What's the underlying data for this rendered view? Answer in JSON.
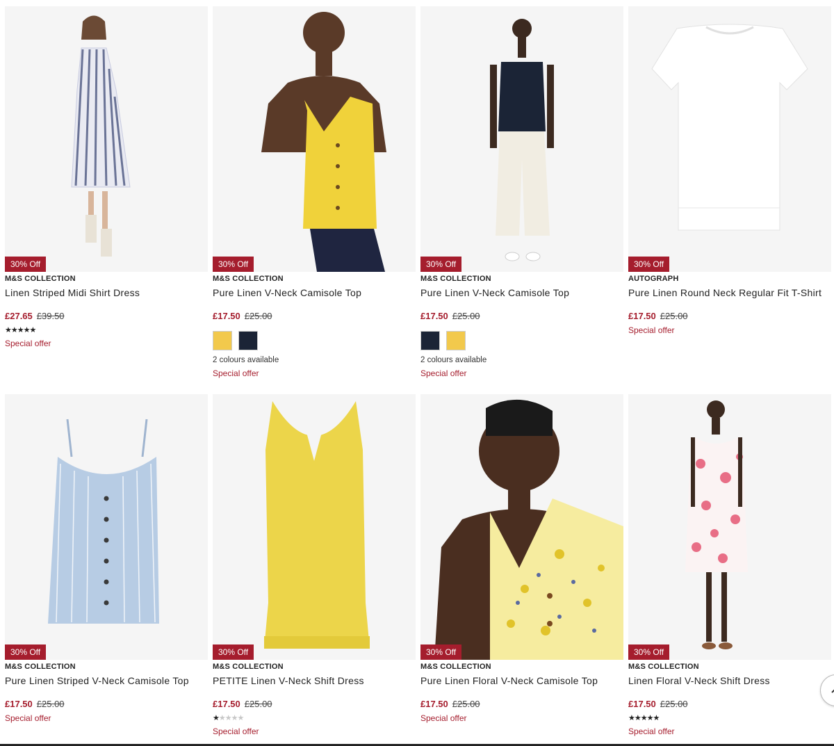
{
  "products": [
    {
      "badge": "30% Off",
      "brand": "M&S COLLECTION",
      "name": "Linen Striped Midi Shirt Dress",
      "price": "£27.65",
      "was": "£39.50",
      "rating": 4.5,
      "colours_text": "",
      "offer": "Special offer"
    },
    {
      "badge": "30% Off",
      "brand": "M&S COLLECTION",
      "name": "Pure Linen V-Neck Camisole Top",
      "price": "£17.50",
      "was": "£25.00",
      "swatches": [
        "#f2c94c",
        "#1b2436"
      ],
      "colours_text": "2 colours available",
      "offer": "Special offer"
    },
    {
      "badge": "30% Off",
      "brand": "M&S COLLECTION",
      "name": "Pure Linen V-Neck Camisole Top",
      "price": "£17.50",
      "was": "£25.00",
      "swatches": [
        "#1b2436",
        "#f2c94c"
      ],
      "colours_text": "2 colours available",
      "offer": "Special offer"
    },
    {
      "badge": "30% Off",
      "brand": "AUTOGRAPH",
      "name": "Pure Linen Round Neck Regular Fit T-Shirt",
      "price": "£17.50",
      "was": "£25.00",
      "offer": "Special offer"
    },
    {
      "badge": "30% Off",
      "brand": "M&S COLLECTION",
      "name": "Pure Linen Striped V-Neck Camisole Top",
      "price": "£17.50",
      "was": "£25.00",
      "offer": "Special offer"
    },
    {
      "badge": "30% Off",
      "brand": "M&S COLLECTION",
      "name": "PETITE Linen V-Neck Shift Dress",
      "price": "£17.50",
      "was": "£25.00",
      "rating": 1,
      "offer": "Special offer"
    },
    {
      "badge": "30% Off",
      "brand": "M&S COLLECTION",
      "name": "Pure Linen Floral V-Neck Camisole Top",
      "price": "£17.50",
      "was": "£25.00",
      "offer": "Special offer"
    },
    {
      "badge": "30% Off",
      "brand": "M&S COLLECTION",
      "name": "Linen Floral V-Neck Shift Dress",
      "price": "£17.50",
      "was": "£25.00",
      "rating": 4.5,
      "offer": "Special offer"
    }
  ],
  "colors": {
    "sale_red": "#a51d2d",
    "yellow": "#f2c94c",
    "navy": "#1b2436"
  },
  "icons": {
    "scroll_top": "chevron-up-icon"
  }
}
